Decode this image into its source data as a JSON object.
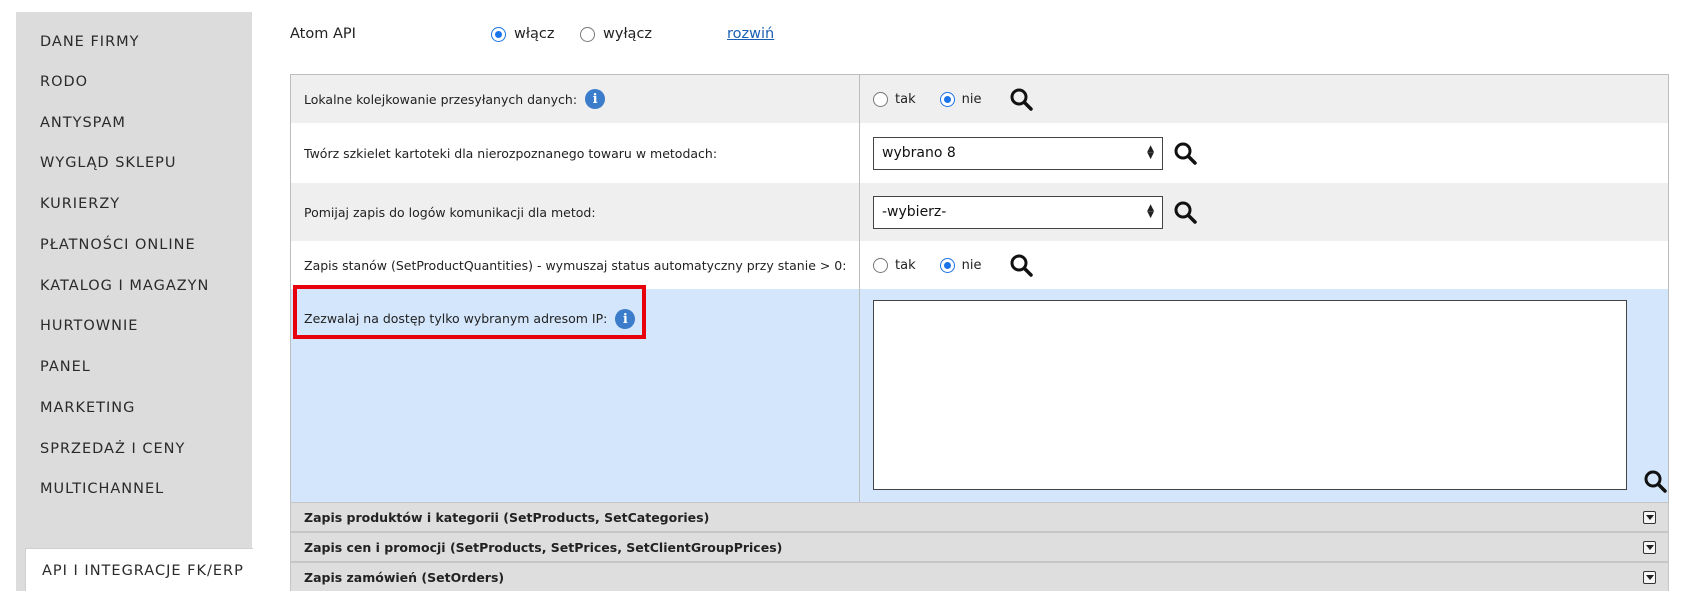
{
  "sidebar": {
    "items": [
      {
        "label": "DANE FIRMY"
      },
      {
        "label": "RODO"
      },
      {
        "label": "ANTYSPAM"
      },
      {
        "label": "WYGLĄD SKLEPU"
      },
      {
        "label": "KURIERZY"
      },
      {
        "label": "PŁATNOŚCI ONLINE"
      },
      {
        "label": "KATALOG I MAGAZYN"
      },
      {
        "label": "HURTOWNIE"
      },
      {
        "label": "PANEL"
      },
      {
        "label": "MARKETING"
      },
      {
        "label": "SPRZEDAŻ I CENY"
      },
      {
        "label": "MULTICHANNEL"
      },
      {
        "label": "API I INTEGRACJE FK/ERP"
      }
    ]
  },
  "atom": {
    "label": "Atom API",
    "on_label": "włącz",
    "off_label": "wyłącz",
    "selected": "włącz",
    "expand_link": "rozwiń"
  },
  "settings": {
    "row1": {
      "label": "Lokalne kolejkowanie przesyłanych danych:",
      "yes": "tak",
      "no": "nie",
      "selected": "nie"
    },
    "row2": {
      "label": "Twórz szkielet kartoteki dla nierozpoznanego towaru w metodach:",
      "value": "wybrano 8"
    },
    "row3": {
      "label": "Pomijaj zapis do logów komunikacji dla metod:",
      "value": "-wybierz-"
    },
    "row4": {
      "label": "Zapis stanów (SetProductQuantities) - wymuszaj status automatyczny przy stanie > 0:",
      "yes": "tak",
      "no": "nie",
      "selected": "nie"
    },
    "row5": {
      "label": "Zezwalaj na dostęp tylko wybranym adresom IP:",
      "value": ""
    }
  },
  "sections": [
    {
      "label": "Zapis produktów i kategorii (SetProducts, SetCategories)"
    },
    {
      "label": "Zapis cen i promocji (SetProducts, SetPrices, SetClientGroupPrices)"
    },
    {
      "label": "Zapis zamówień (SetOrders)"
    }
  ],
  "colors": {
    "accent": "#1a73e8",
    "highlight": "#e8000b",
    "info": "#3b7ccb"
  }
}
